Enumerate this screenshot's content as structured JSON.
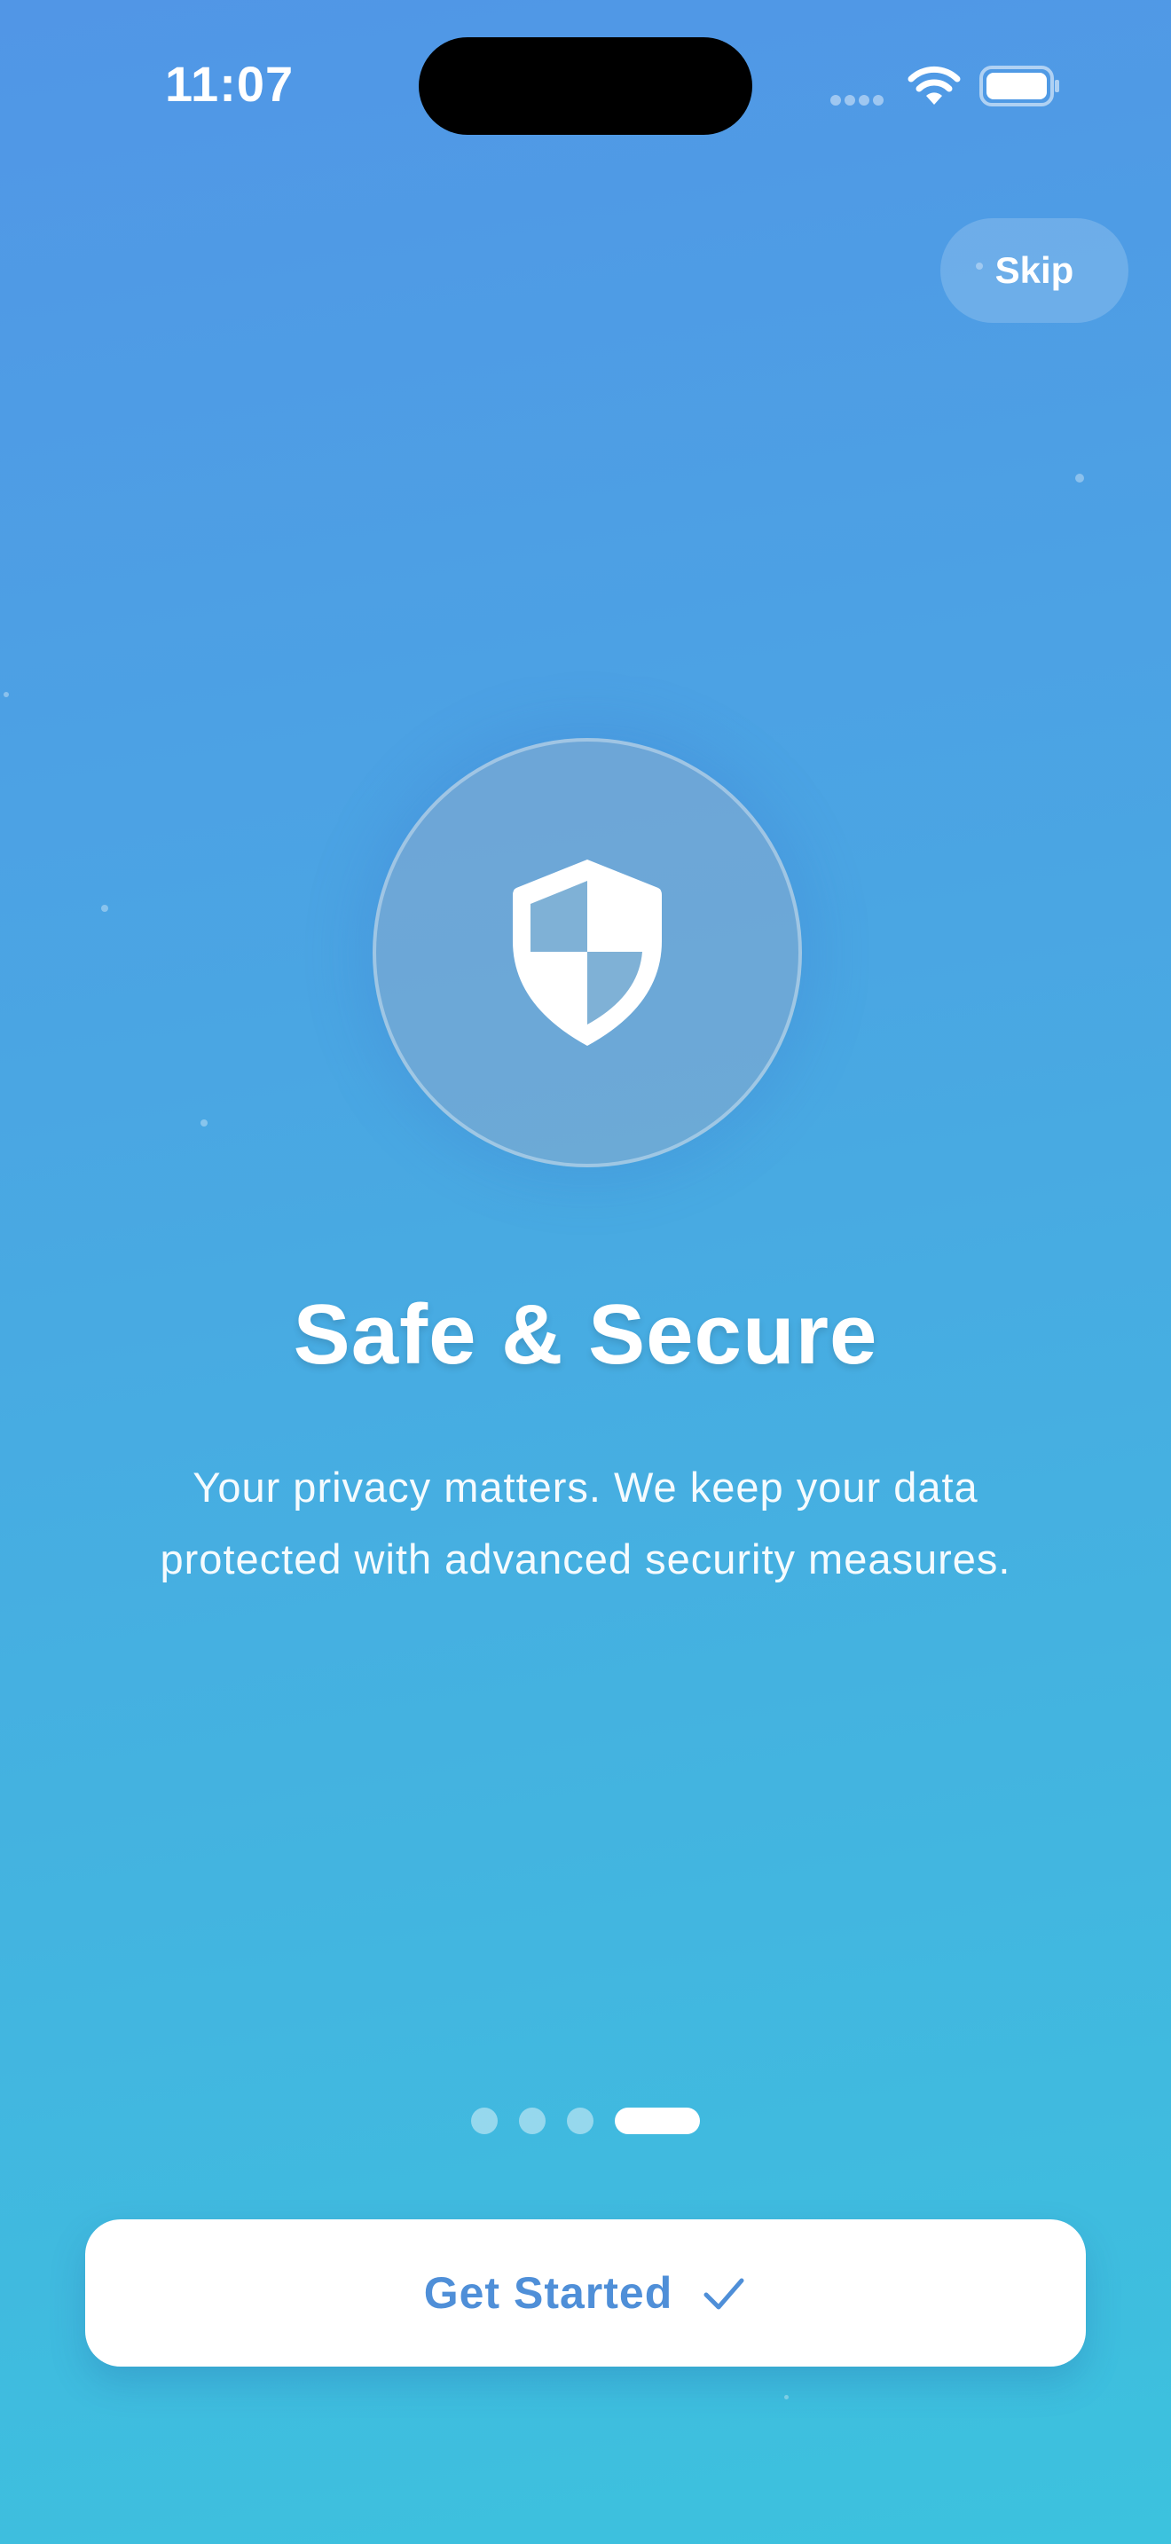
{
  "status_bar": {
    "time": "11:07",
    "wifi_icon": "wifi-icon",
    "battery_icon": "battery-icon"
  },
  "header": {
    "skip_label": "Skip"
  },
  "hero": {
    "icon": "shield-icon",
    "title": "Safe & Secure",
    "description": "Your privacy matters. We keep your data protected with advanced security measures."
  },
  "pager": {
    "total_pages": 4,
    "current_page": 4
  },
  "cta": {
    "label": "Get Started",
    "icon": "checkmark-icon"
  },
  "colors": {
    "gradient_top": "#5196e6",
    "gradient_bottom": "#3cc2de",
    "button_text": "#4f8fd8"
  }
}
